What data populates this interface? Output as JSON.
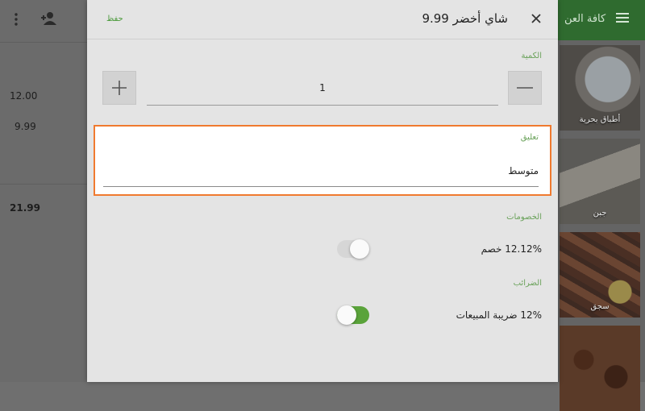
{
  "background_left": {
    "values": [
      "12.00",
      "9.99",
      "21.99"
    ]
  },
  "background_right": {
    "app_title": "كافة العن",
    "tiles": [
      {
        "label": "أطباق بحرية"
      },
      {
        "label": "جبن"
      },
      {
        "label": "سجق"
      },
      {
        "label": ""
      }
    ]
  },
  "dialog": {
    "title": "شاي أخضر 9.99",
    "save_label": "حفظ",
    "quantity_label": "الكمية",
    "quantity_value": "1",
    "comment_label": "تعليق",
    "comment_value": "متوسط",
    "discounts_label": "الخصومات",
    "discount_item": "12.12% خصم",
    "discount_enabled": false,
    "taxes_label": "الضرائب",
    "tax_item": "12% ضريبة المبيعات",
    "tax_enabled": true
  },
  "colors": {
    "accent_green": "#6aa25a",
    "toggle_on": "#5aa33a",
    "highlight_orange": "#f07a2f",
    "appbar_green": "#2f6b2f"
  },
  "icons": [
    "more-vert-icon",
    "add-person-icon",
    "close-icon",
    "minus-icon",
    "plus-icon",
    "menu-icon"
  ]
}
